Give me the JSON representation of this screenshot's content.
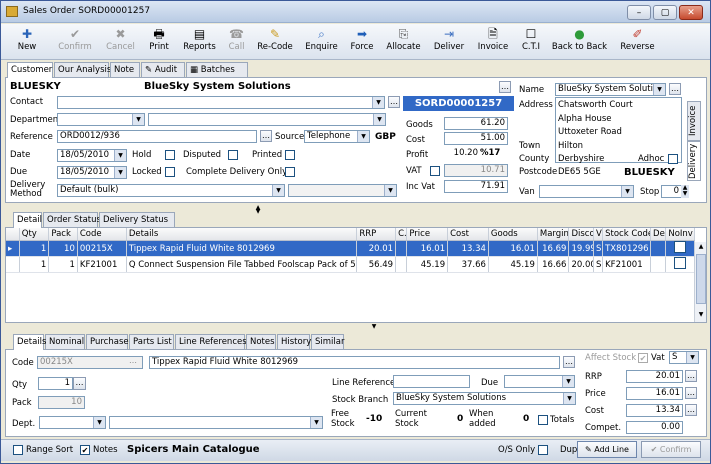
{
  "window": {
    "title": "Sales Order SORD00001257"
  },
  "toolbar": [
    {
      "label": "New",
      "icon": "✚",
      "enabled": true
    },
    {
      "label": "Confirm",
      "icon": "✔",
      "enabled": false
    },
    {
      "label": "Cancel",
      "icon": "✖",
      "enabled": false
    },
    {
      "label": "Print",
      "icon": "🖶",
      "enabled": true
    },
    {
      "label": "Reports",
      "icon": "▤",
      "enabled": true
    },
    {
      "label": "Call",
      "icon": "☎",
      "enabled": false
    },
    {
      "label": "Re-Code",
      "icon": "✎",
      "enabled": true
    },
    {
      "label": "Enquire",
      "icon": "⌕",
      "enabled": true
    },
    {
      "label": "Force",
      "icon": "➡",
      "enabled": true
    },
    {
      "label": "Allocate",
      "icon": "⎘",
      "enabled": true
    },
    {
      "label": "Deliver",
      "icon": "⇥",
      "enabled": true
    },
    {
      "label": "Invoice",
      "icon": "🗎",
      "enabled": true
    },
    {
      "label": "C.T.I",
      "icon": "☐",
      "enabled": true
    },
    {
      "label": "Back to Back",
      "icon": "●",
      "enabled": true
    },
    {
      "label": "Reverse",
      "icon": "✐",
      "enabled": true
    }
  ],
  "tabs": {
    "customer": "Customer",
    "analysis": "Our Analysis",
    "note": "Note",
    "audit": "Audit",
    "batches": "Batches"
  },
  "header": {
    "account": "BLUESKY",
    "company": "BlueSky System Solutions",
    "contact_label": "Contact",
    "department_label": "Department",
    "reference_label": "Reference",
    "reference": "ORD0012/936",
    "source_label": "Source",
    "source": "Telephone",
    "currency": "GBP",
    "date_label": "Date",
    "date": "18/05/2010",
    "due_label": "Due",
    "due": "18/05/2010",
    "hold": "Hold",
    "disputed": "Disputed",
    "printed": "Printed",
    "locked": "Locked",
    "complete_delivery": "Complete Delivery Only",
    "delivery_method_label": "Delivery Method",
    "delivery_method": "Default (bulk)",
    "order_number": "SORD00001257",
    "goods_label": "Goods",
    "goods": "61.20",
    "cost_label": "Cost",
    "cost": "51.00",
    "profit_label": "Profit",
    "profit": "10.20",
    "profit_pct": "%17",
    "vat_label": "VAT",
    "vat": "10.71",
    "incvat_label": "Inc Vat",
    "incvat": "71.91"
  },
  "address": {
    "name_label": "Name",
    "name": "BlueSky System Solution",
    "address_label": "Address",
    "line1": "Chatsworth Court",
    "line2": "Alpha House",
    "line3": "Uttoxeter Road",
    "town_label": "Town",
    "town": "Hilton",
    "county_label": "County",
    "county": "Derbyshire",
    "adhoc": "Adhoc",
    "postcode_label": "Postcode",
    "postcode": "DE65 5GE",
    "account": "BLUESKY",
    "van_label": "Van",
    "stop_label": "Stop",
    "stop": "0",
    "side_tab_invoice": "Invoice",
    "side_tab_delivery": "Delivery"
  },
  "lines_tabs": {
    "detail": "Detail",
    "order_status": "Order Status",
    "delivery_status": "Delivery Status"
  },
  "lines": {
    "columns": [
      "Qty",
      "Pack",
      "Code",
      "Details",
      "RRP",
      "C.",
      "Price",
      "Cost",
      "Goods",
      "Margin",
      "Disco",
      "V",
      "Stock Code",
      "De",
      "NoInv"
    ],
    "rows": [
      [
        "1",
        "10",
        "00215X",
        "Tippex Rapid Fluid White 8012969",
        "20.01",
        "",
        "16.01",
        "13.34",
        "16.01",
        "16.69",
        "19.99",
        "S",
        "TX801296",
        "",
        ""
      ],
      [
        "1",
        "1",
        "KF21001",
        "Q Connect Suspension File Tabbed Foolscap Pack of 50 K",
        "56.49",
        "",
        "45.19",
        "37.66",
        "45.19",
        "16.66",
        "20.00",
        "S",
        "KF21001",
        "",
        ""
      ]
    ]
  },
  "detail_tabs": [
    "Details",
    "Nominal",
    "Purchase",
    "Parts List",
    "Line References",
    "Notes",
    "History",
    "Similar"
  ],
  "detail": {
    "code_label": "Code",
    "code": "00215X",
    "description": "Tippex Rapid Fluid White 8012969",
    "qty_label": "Qty",
    "qty": "1",
    "pack_label": "Pack",
    "pack": "10",
    "dept_label": "Dept.",
    "line_ref_label": "Line Reference",
    "due_label": "Due",
    "stock_branch_label": "Stock Branch",
    "stock_branch": "BlueSky System Solutions",
    "free_stock_label": "Free Stock",
    "free_stock": "-10",
    "current_stock_label": "Current Stock",
    "current_stock": "0",
    "when_added_label": "When added",
    "when_added": "0",
    "totals": "Totals",
    "affect_stock": "Affect Stock",
    "vat_label": "Vat",
    "vat_code": "S",
    "rrp_label": "RRP",
    "rrp": "20.01",
    "price_label": "Price",
    "price": "16.01",
    "cost_label": "Cost",
    "cost": "13.34",
    "compet_label": "Compet.",
    "compet": "0.00"
  },
  "status": {
    "range_sort": "Range Sort",
    "notes": "Notes",
    "catalogue": "Spicers Main Catalogue",
    "os_only": "O/S Only",
    "dup": "Dup",
    "add_line": "Add Line",
    "confirm": "Confirm"
  }
}
